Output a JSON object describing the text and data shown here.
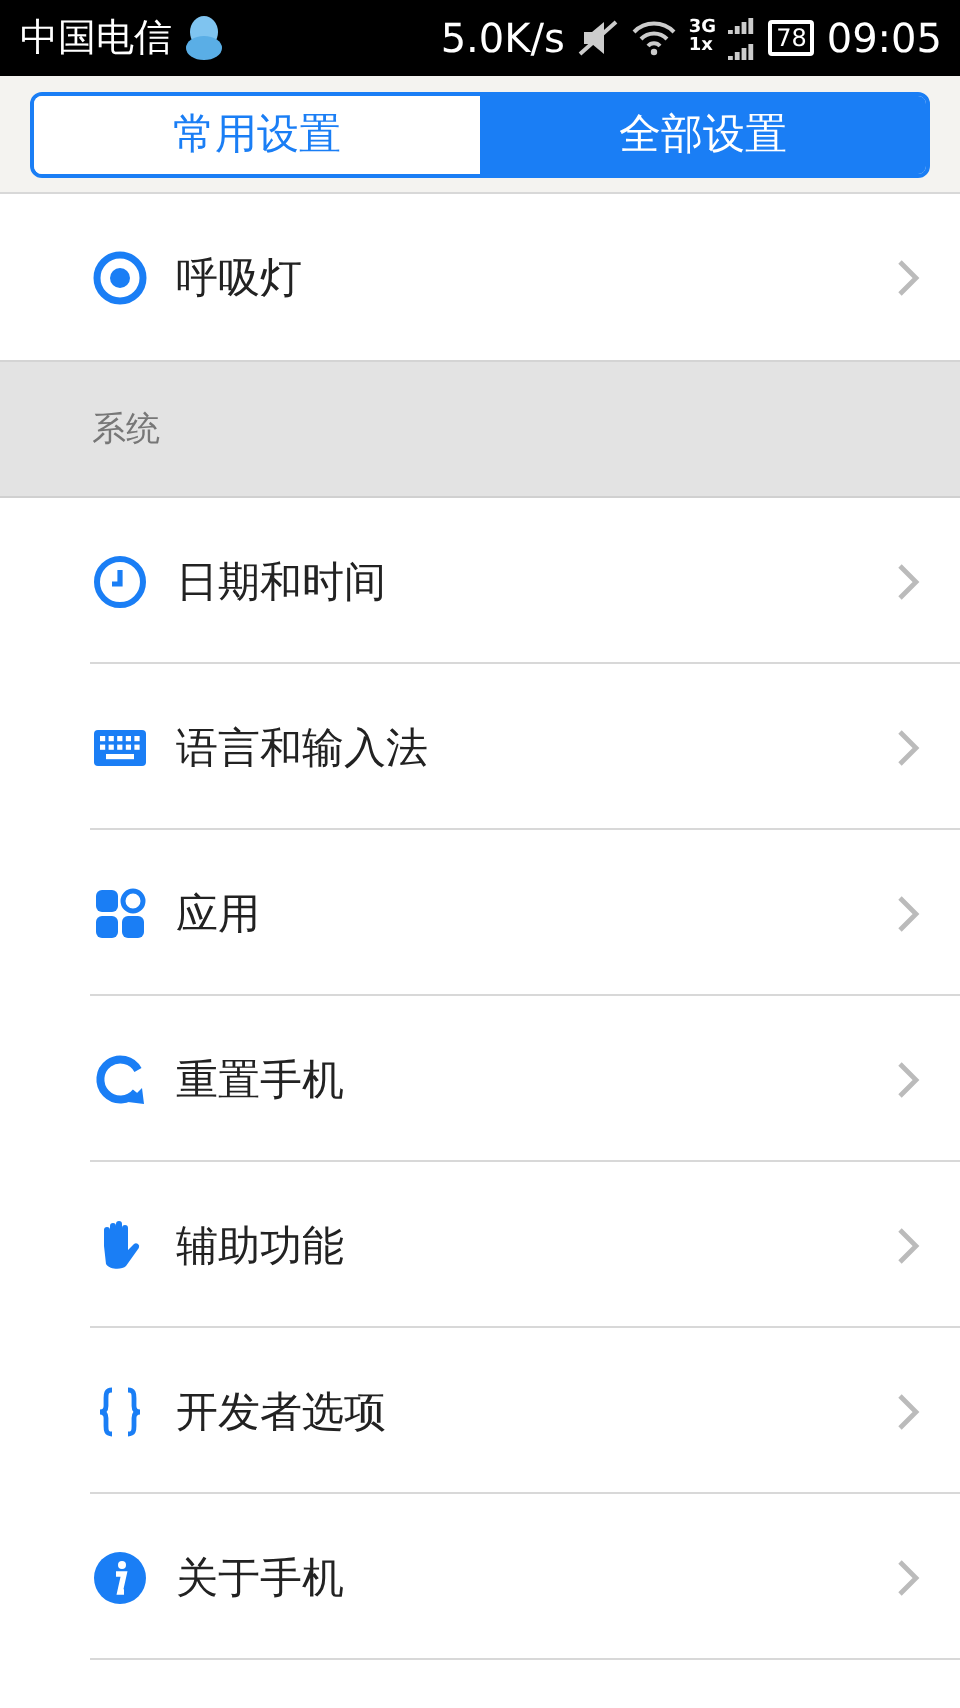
{
  "status_bar": {
    "carrier": "中国电信",
    "speed": "5.0K/s",
    "network_top": "3G",
    "network_bottom": "1x",
    "battery": "78",
    "time": "09:05"
  },
  "tabs": [
    {
      "label": "常用设置",
      "selected": false
    },
    {
      "label": "全部设置",
      "selected": true
    }
  ],
  "top_items": [
    {
      "label": "呼吸灯"
    }
  ],
  "sections": [
    {
      "title": "系统",
      "items": [
        {
          "label": "日期和时间"
        },
        {
          "label": "语言和输入法"
        },
        {
          "label": "应用"
        },
        {
          "label": "重置手机"
        },
        {
          "label": "辅助功能"
        },
        {
          "label": "开发者选项"
        },
        {
          "label": "关于手机"
        }
      ]
    }
  ]
}
